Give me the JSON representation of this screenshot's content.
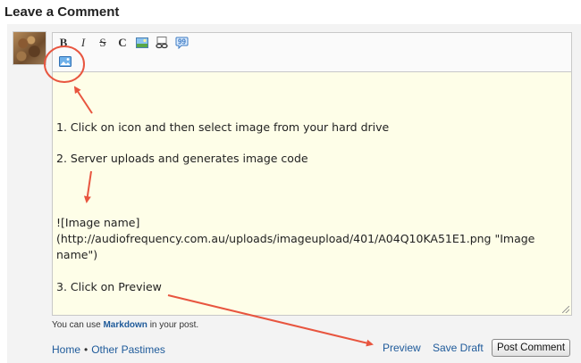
{
  "page": {
    "heading": "Leave a Comment"
  },
  "toolbar": {
    "bold_label": "B",
    "italic_label": "I",
    "strike_label": "S",
    "code_label": "C"
  },
  "editor": {
    "lines": [
      "1. Click on icon and then select image from your hard drive",
      "2. Server uploads and generates image code",
      "![Image name](http://audiofrequency.com.au/uploads/imageupload/401/A04Q10KA51E1.png \"Image name\")",
      "3. Click on Preview"
    ]
  },
  "hint": {
    "prefix": "You can use ",
    "link": "Markdown",
    "suffix": " in your post."
  },
  "footer": {
    "home_link": "Home",
    "separator": "•",
    "category_link": "Other Pastimes",
    "preview_link": "Preview",
    "draft_link": "Save Draft",
    "post_button": "Post Comment"
  },
  "icons": {
    "picture": "image-insert-icon",
    "upload": "image-upload-icon",
    "link": "link-icon",
    "quote": "quote-icon"
  },
  "colors": {
    "annotation": "#e8553f",
    "link": "#1e5a9a",
    "editor_bg": "#fefee8"
  }
}
